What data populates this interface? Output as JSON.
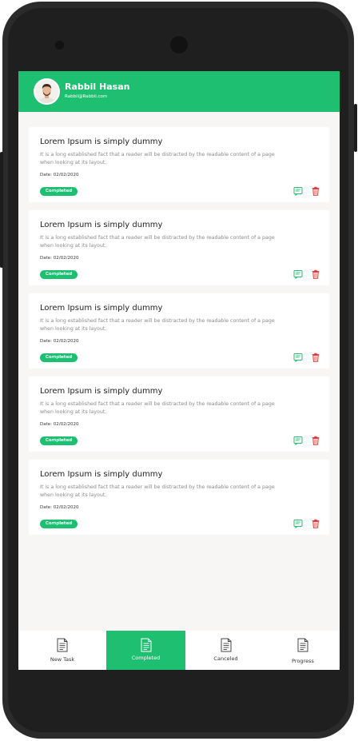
{
  "colors": {
    "accent": "#1fbf72",
    "delete": "#e53935",
    "background": "#f7f6f5"
  },
  "header": {
    "user_name": "Rabbil Hasan",
    "user_email": "Rabbil@Rabbil.com",
    "avatar_icon": "user-avatar"
  },
  "tasks": [
    {
      "title": "Lorem Ipsum is simply dummy",
      "description": "It is a long established fact that a reader will be distracted by the readable content of a page when looking at its layout.",
      "date": "Date: 02/02/2020",
      "status": "Completed"
    },
    {
      "title": "Lorem Ipsum is simply dummy",
      "description": "It is a long established fact that a reader will be distracted by the readable content of a page when looking at its layout.",
      "date": "Date: 02/02/2020",
      "status": "Completed"
    },
    {
      "title": "Lorem Ipsum is simply dummy",
      "description": "It is a long established fact that a reader will be distracted by the readable content of a page when looking at its layout.",
      "date": "Date: 02/02/2020",
      "status": "Completed"
    },
    {
      "title": "Lorem Ipsum is simply dummy",
      "description": "It is a long established fact that a reader will be distracted by the readable content of a page when looking at its layout.",
      "date": "Date: 02/02/2020",
      "status": "Completed"
    },
    {
      "title": "Lorem Ipsum is simply dummy",
      "description": "It is a long established fact that a reader will be distracted by the readable content of a page when looking at its layout.",
      "date": "Date: 02/02/2020",
      "status": "Completed"
    }
  ],
  "task_actions": {
    "edit_icon": "message-edit-icon",
    "delete_icon": "trash-icon"
  },
  "bottom_nav": [
    {
      "label": "New Task",
      "icon": "document-icon",
      "active": false
    },
    {
      "label": "Completed",
      "icon": "document-icon",
      "active": true
    },
    {
      "label": "Canceled",
      "icon": "document-icon",
      "active": false
    },
    {
      "label": "Progress",
      "icon": "document-icon",
      "active": false
    }
  ]
}
